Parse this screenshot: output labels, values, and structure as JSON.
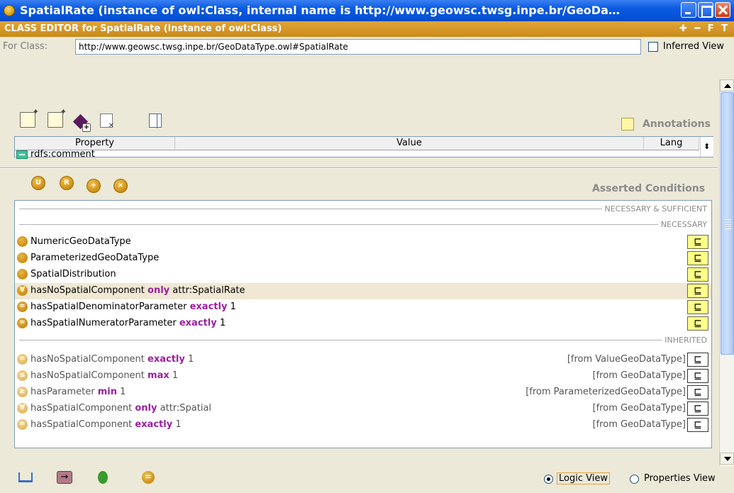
{
  "window": {
    "title": "SpatialRate   (instance of owl:Class, internal name is http://www.geowsc.twsg.inpe.br/GeoDa…"
  },
  "class_editor": {
    "header": "CLASS EDITOR for SpatialRate   (instance of owl:Class)",
    "header_controls": "✚ ━ F T",
    "for_class_label": "For Class:",
    "for_class_value": "http://www.geowsc.twsg.inpe.br/GeoDataType.owl#SpatialRate",
    "inferred_view_label": "Inferred View"
  },
  "annotations": {
    "title": "Annotations",
    "columns": [
      "Property",
      "Value",
      "Lang"
    ],
    "rows": [
      {
        "property": "rdfs:comment",
        "value": "",
        "lang": ""
      }
    ]
  },
  "asserted_conditions": {
    "title": "Asserted Conditions",
    "necessary_sufficient_label": "NECESSARY & SUFFICIENT",
    "necessary_label": "NECESSARY",
    "inherited_label": "INHERITED",
    "subclass_symbol": "⊑",
    "necessary": [
      {
        "icon": "named-class-icon",
        "prop": "NumericGeoDataType",
        "kw": "",
        "rest": ""
      },
      {
        "icon": "named-class-icon",
        "prop": "ParameterizedGeoDataType",
        "kw": "",
        "rest": ""
      },
      {
        "icon": "named-class-icon",
        "prop": "SpatialDistribution",
        "kw": "",
        "rest": ""
      },
      {
        "icon": "all-values-icon",
        "prop": "hasNoSpatialComponent",
        "kw": "only",
        "rest": "attr:SpatialRate"
      },
      {
        "icon": "cardinality-icon",
        "prop": "hasSpatialDenominatorParameter",
        "kw": "exactly",
        "rest": "1"
      },
      {
        "icon": "cardinality-icon",
        "prop": "hasSpatialNumeratorParameter",
        "kw": "exactly",
        "rest": "1"
      }
    ],
    "inherited": [
      {
        "icon": "cardinality-icon",
        "prop": "hasNoSpatialComponent",
        "kw": "exactly",
        "rest": "1",
        "from": "[from ValueGeoDataType]"
      },
      {
        "icon": "max-cardinality-icon",
        "prop": "hasNoSpatialComponent",
        "kw": "max",
        "rest": "1",
        "from": "[from GeoDataType]"
      },
      {
        "icon": "min-cardinality-icon",
        "prop": "hasParameter",
        "kw": "min",
        "rest": "1",
        "from": "[from ParameterizedGeoDataType]"
      },
      {
        "icon": "all-values-icon",
        "prop": "hasSpatialComponent",
        "kw": "only",
        "rest": "attr:Spatial",
        "from": "[from GeoDataType]"
      },
      {
        "icon": "cardinality-icon",
        "prop": "hasSpatialComponent",
        "kw": "exactly",
        "rest": "1",
        "from": "[from GeoDataType]"
      }
    ]
  },
  "bottom": {
    "logic_view_label": "Logic View",
    "properties_view_label": "Properties View",
    "selected_view": "Logic View"
  },
  "colors": {
    "title_bar": "#0552d6",
    "editor_header": "#d4971f",
    "keyword": "#9b1fa0",
    "class_icon": "#c98a12"
  }
}
